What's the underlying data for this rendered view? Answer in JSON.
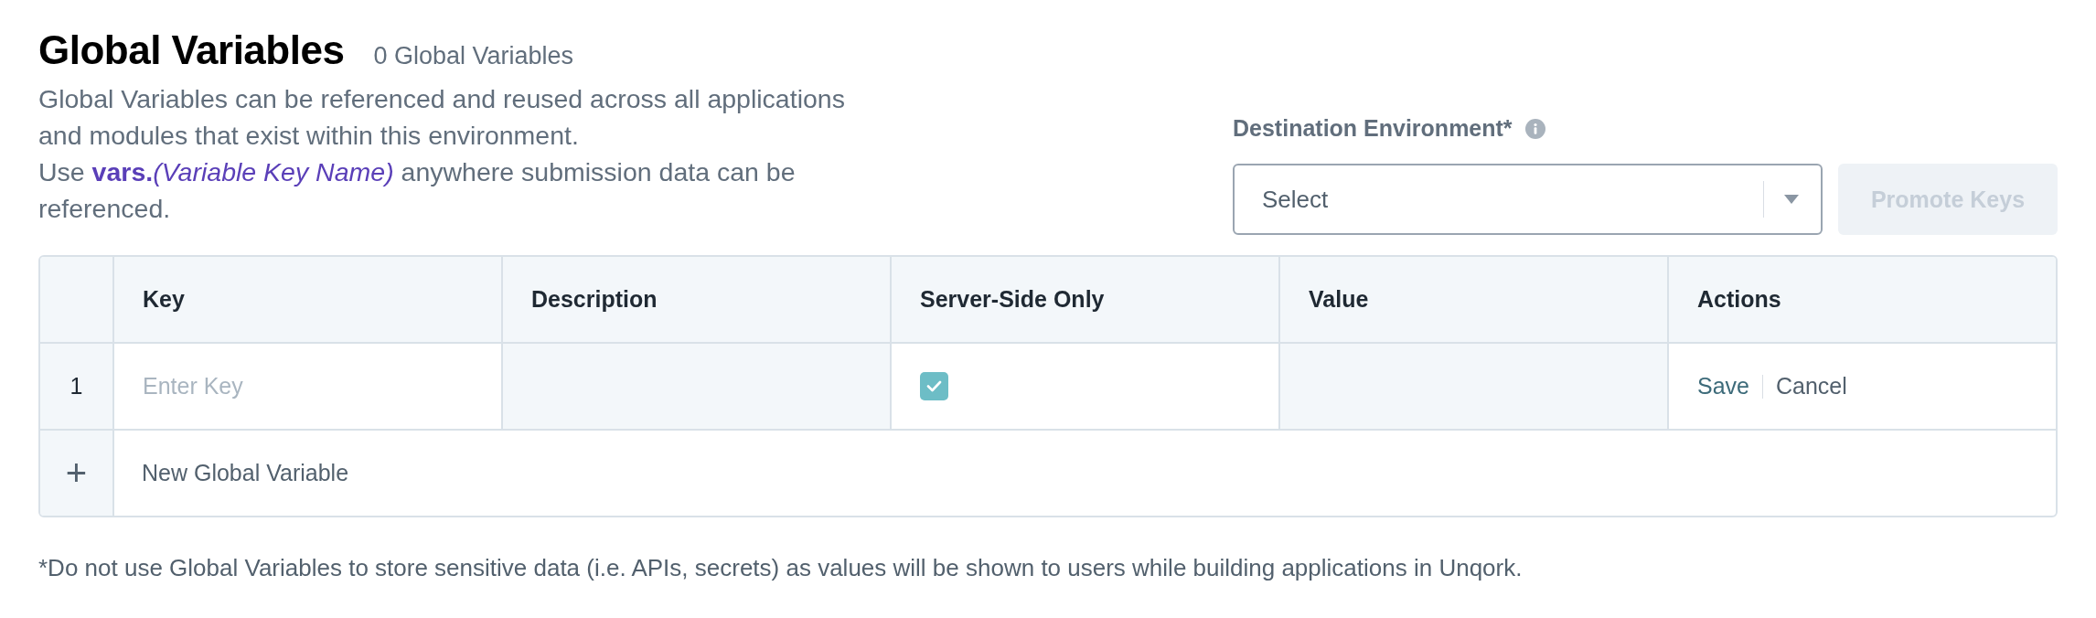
{
  "header": {
    "title": "Global Variables",
    "count": "0 Global Variables",
    "description": [
      "Global Variables can be referenced and reused across all applications and modules that exist within this environment.",
      {
        "prefix": "Use ",
        "code": "vars.",
        "hint": "(Variable Key Name)",
        "suffix": " anywhere submission data can be referenced."
      }
    ]
  },
  "promote": {
    "label": "Destination Environment*",
    "select": {
      "placeholder": "Select"
    },
    "button": {
      "label": "Promote Keys",
      "disabled": true
    }
  },
  "table": {
    "columns": [
      "Key",
      "Description",
      "Server-Side Only",
      "Value",
      "Actions"
    ],
    "rows": [
      {
        "index": "1",
        "cells": [
          {
            "kind": "input",
            "placeholder": "Enter Key"
          },
          {
            "kind": "readonly"
          },
          {
            "kind": "checkbox",
            "checked": true
          },
          {
            "kind": "readonly"
          },
          {
            "kind": "actions",
            "actions": [
              "Save",
              "Cancel"
            ]
          }
        ]
      }
    ],
    "add_row": {
      "icon": "+",
      "label": "New Global Variable"
    }
  },
  "footnote": "*Do not use Global Variables to store sensitive data (i.e. APIs, secrets) as values will be shown to users while building applications in Unqork."
}
